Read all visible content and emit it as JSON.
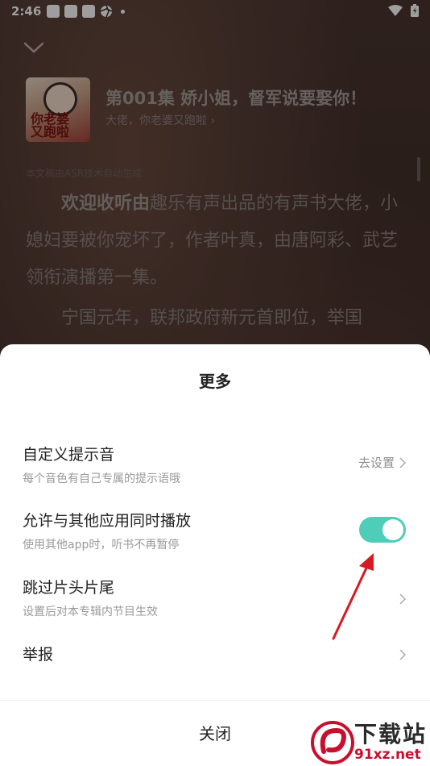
{
  "status_bar": {
    "time": "2:46"
  },
  "player": {
    "cover_text": "你老婆\n又跑啦",
    "episode_title": "第001集 娇小姐，督军说要娶你！",
    "album_name": "大佬，你老婆又跑啦",
    "asr_note": "本文稿由ASR技术自动生成",
    "transcript_lead": "欢迎收听由",
    "transcript_p1_rest": "趣乐有声出品的有声书大佬，小媳妇要被你宠坏了，作者叶真，由唐阿彩、武艺领衔演播第一集。",
    "transcript_p2": "宁国元年，联邦政府新元首即位，举国"
  },
  "sheet": {
    "title": "更多",
    "rows": [
      {
        "label": "自定义提示音",
        "desc": "每个音色有自己专属的提示语哦",
        "action": "去设置"
      },
      {
        "label": "允许与其他应用同时播放",
        "desc": "使用其他app时，听书不再暂停",
        "toggle_on": true
      },
      {
        "label": "跳过片头片尾",
        "desc": "设置后对本专辑内节目生效"
      },
      {
        "label": "举报"
      }
    ],
    "close_label": "关闭"
  },
  "colors": {
    "accent_toggle": "#4ecdb8",
    "annotation_arrow": "#d71920"
  },
  "watermark": {
    "top": "下载站",
    "bottom": "91xz.net"
  }
}
